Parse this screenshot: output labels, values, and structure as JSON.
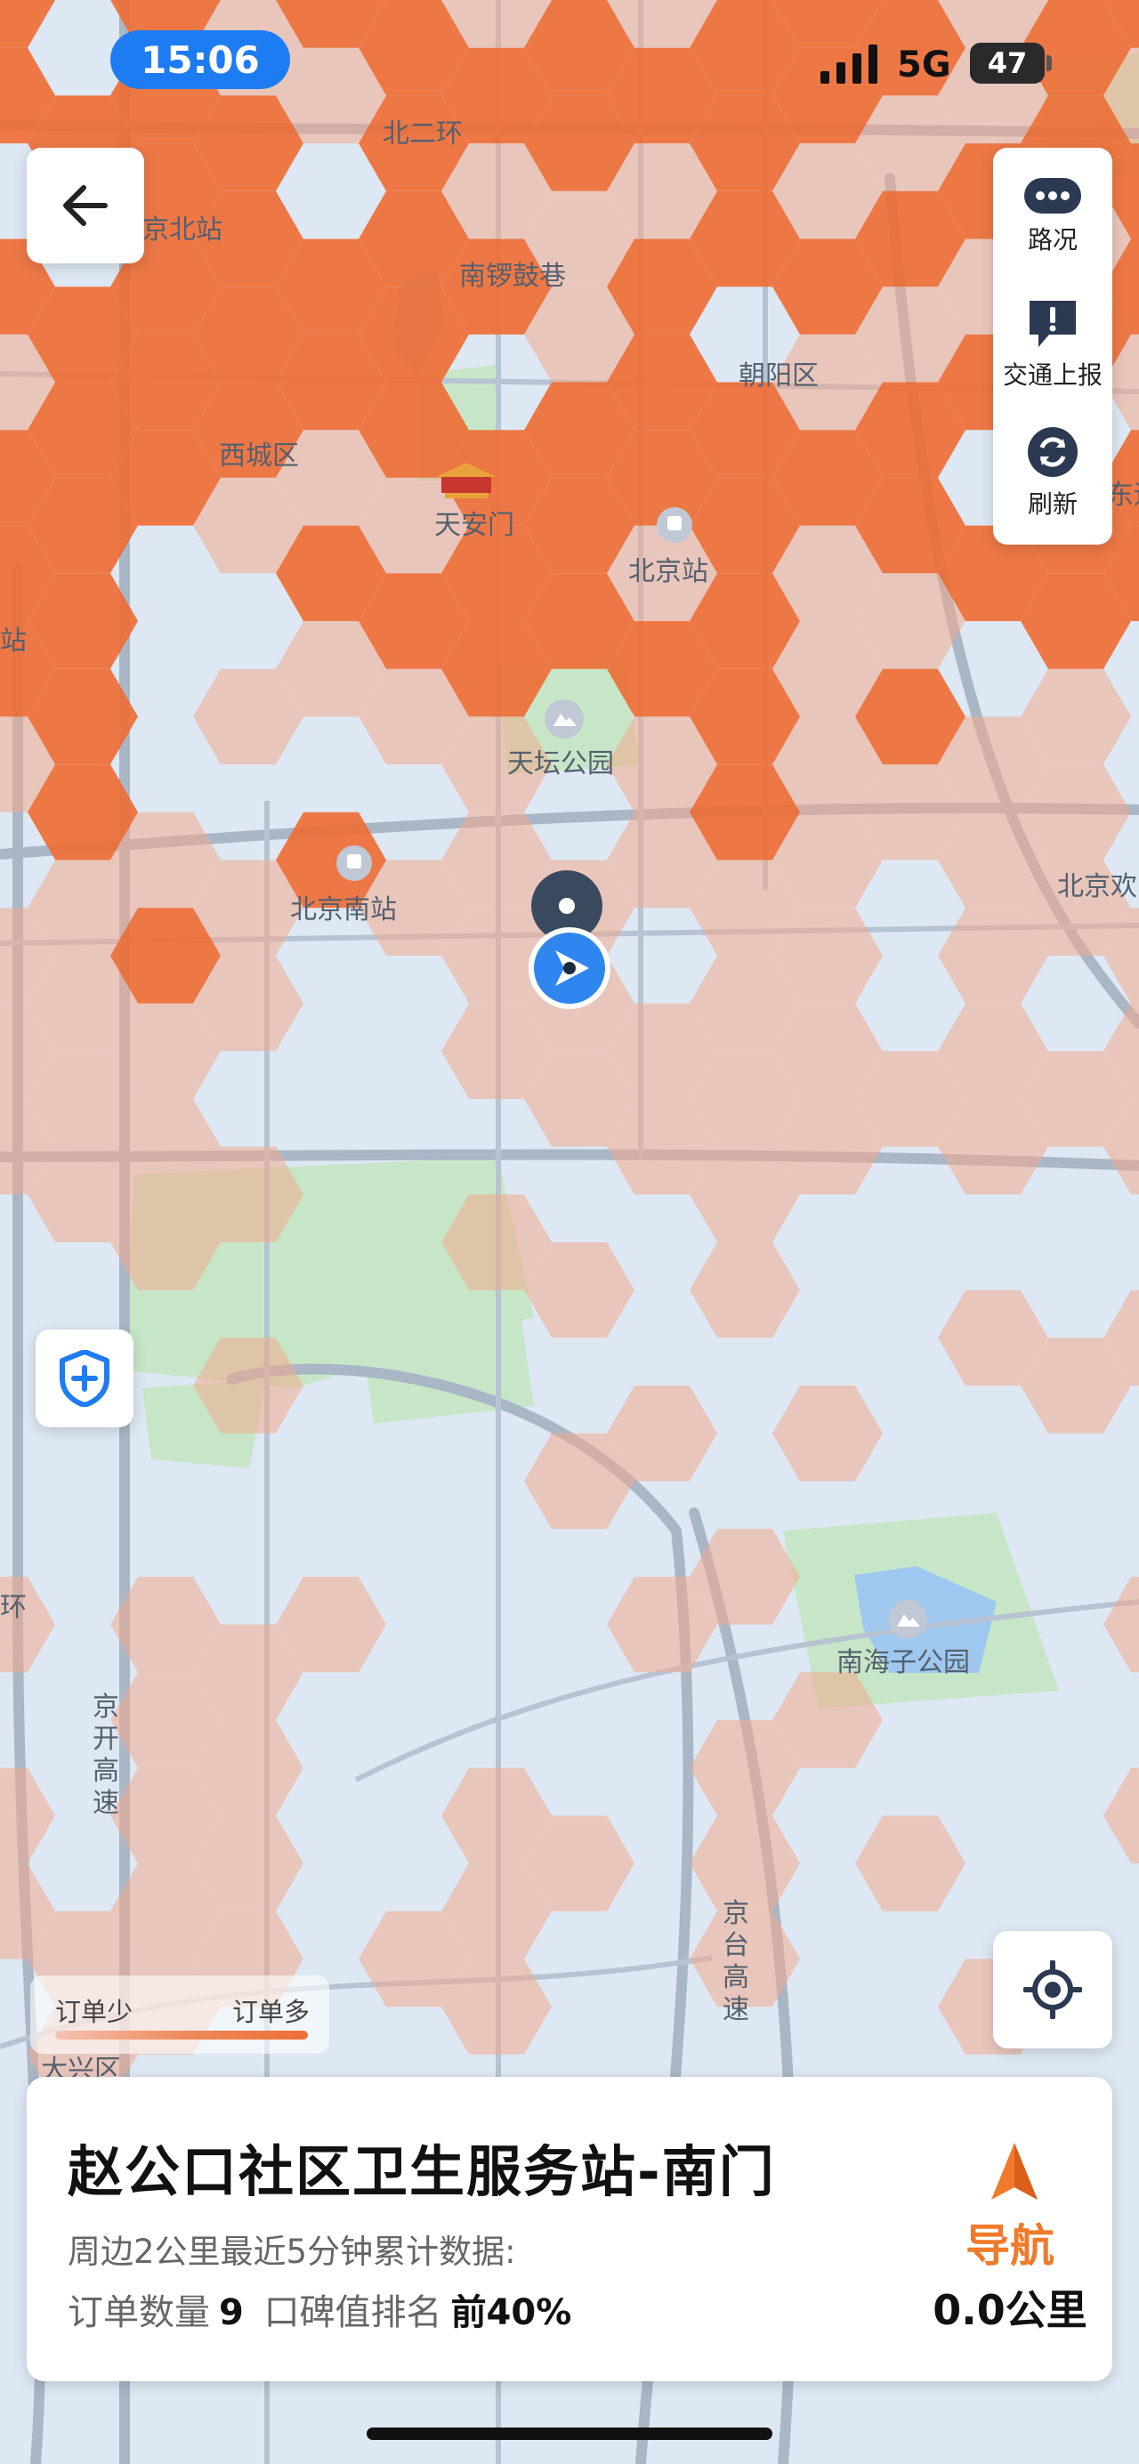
{
  "status_bar": {
    "time": "15:06",
    "network": "5G",
    "battery": "47"
  },
  "map": {
    "labels": [
      {
        "key": "bei_er_huan",
        "text": "北二环"
      },
      {
        "key": "bj_north",
        "text": "京北站"
      },
      {
        "key": "nan_luo",
        "text": "南锣鼓巷"
      },
      {
        "key": "chaoyang",
        "text": "朝阳区"
      },
      {
        "key": "xicheng",
        "text": "西城区"
      },
      {
        "key": "tiananmen",
        "text": "天安门"
      },
      {
        "key": "bj_station",
        "text": "北京站"
      },
      {
        "key": "left_cut",
        "text": "站"
      },
      {
        "key": "tiantan",
        "text": "天坛公园"
      },
      {
        "key": "bj_south",
        "text": "北京南站"
      },
      {
        "key": "bj_huan",
        "text": "北京欢"
      },
      {
        "key": "nanhaizi",
        "text": "南海子公园"
      },
      {
        "key": "huan",
        "text": "环"
      },
      {
        "key": "jingkai",
        "text": "京开高速"
      },
      {
        "key": "jingtai",
        "text": "京台高速"
      },
      {
        "key": "daxing",
        "text": "大兴区"
      },
      {
        "key": "right_cut",
        "text": "东运"
      }
    ]
  },
  "toolbar": {
    "traffic_label": "路况",
    "report_label": "交通上报",
    "refresh_label": "刷新"
  },
  "legend": {
    "low_label": "订单少",
    "high_label": "订单多"
  },
  "info_card": {
    "title": "赵公口社区卫生服务站-南门",
    "subtitle": "周边2公里最近5分钟累计数据:",
    "orders_label": "订单数量",
    "orders_value": "9",
    "rank_label": "口碑值排名",
    "rank_value": "前40%",
    "nav_label": "导航",
    "distance": "0.0公里"
  },
  "colors": {
    "hex_dark": "#ee6e36",
    "hex_light": "#f2a98c",
    "accent": "#f07a2c",
    "blue": "#1e7cf2"
  },
  "icons": [
    "back-arrow-icon",
    "traffic-icon",
    "report-icon",
    "refresh-icon",
    "shield-plus-icon",
    "locate-icon",
    "navigation-arrow-icon",
    "pin-icon",
    "location-arrow-icon",
    "palace-icon",
    "park-icon",
    "train-icon"
  ]
}
